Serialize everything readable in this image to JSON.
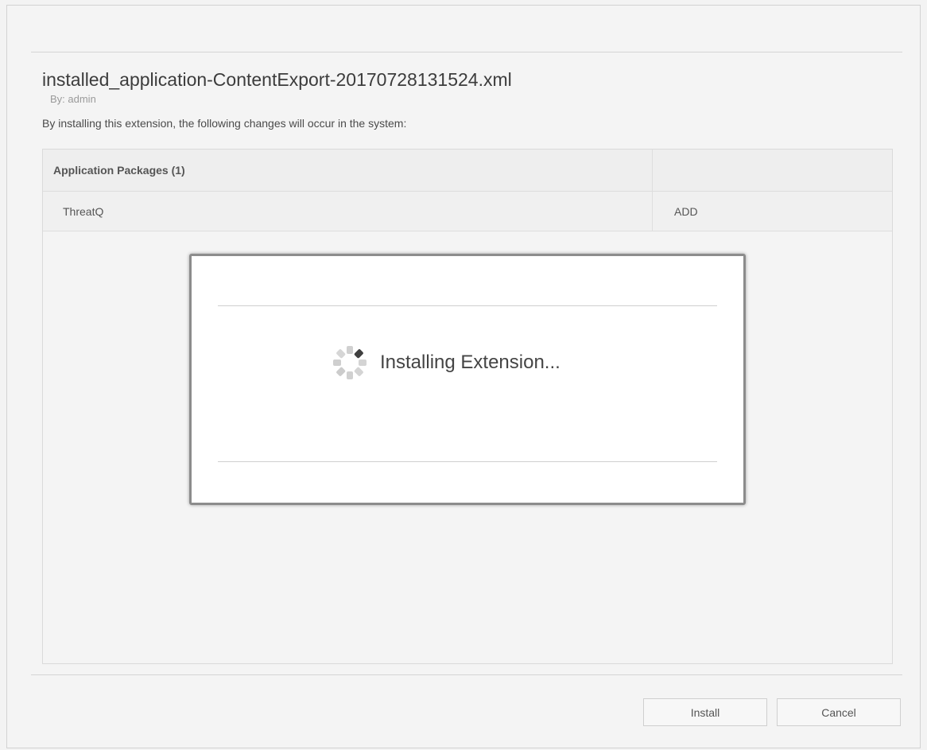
{
  "dialog": {
    "file_title": "installed_application-ContentExport-20170728131524.xml",
    "author": "By: admin",
    "description": "By installing this extension, the following changes will occur in the system:"
  },
  "changes_table": {
    "header": {
      "name": "Application Packages (1)",
      "action": ""
    },
    "rows": [
      {
        "name": "ThreatQ",
        "action": "ADD"
      }
    ]
  },
  "progress": {
    "message": "Installing Extension...",
    "spinner_icon": "loading-spinner-icon"
  },
  "buttons": {
    "install_label": "Install",
    "cancel_label": "Cancel"
  }
}
